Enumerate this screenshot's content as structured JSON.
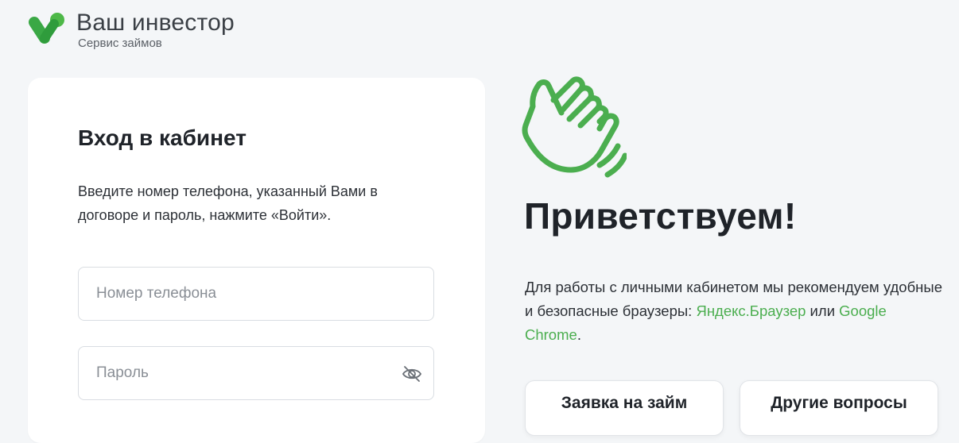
{
  "brand": {
    "title": "Ваш инвестор",
    "subtitle": "Сервис займов",
    "accent_color": "#4bae4f",
    "logo_icon": "brand-v-logo"
  },
  "login": {
    "title": "Вход в кабинет",
    "description": "Введите номер телефона, указанный Вами в договоре и пароль, нажмите «Войти».",
    "phone_placeholder": "Номер телефона",
    "phone_value": "",
    "password_placeholder": "Пароль",
    "password_value": "",
    "password_toggle_icon": "eye-off-icon"
  },
  "welcome": {
    "icon": "waving-hand-icon",
    "title": "Приветствуем!",
    "text_part1": "Для работы с личными кабинетом мы рекомендуем удобные",
    "text_part2": "и безопасные браузеры: ",
    "link_yandex": "Яндекс.Браузер",
    "text_or": " или ",
    "link_chrome_1": "Google",
    "link_chrome_2": "Chrome",
    "text_end": "."
  },
  "buttons": {
    "loan_request": "Заявка на займ",
    "other_questions": "Другие вопросы"
  }
}
